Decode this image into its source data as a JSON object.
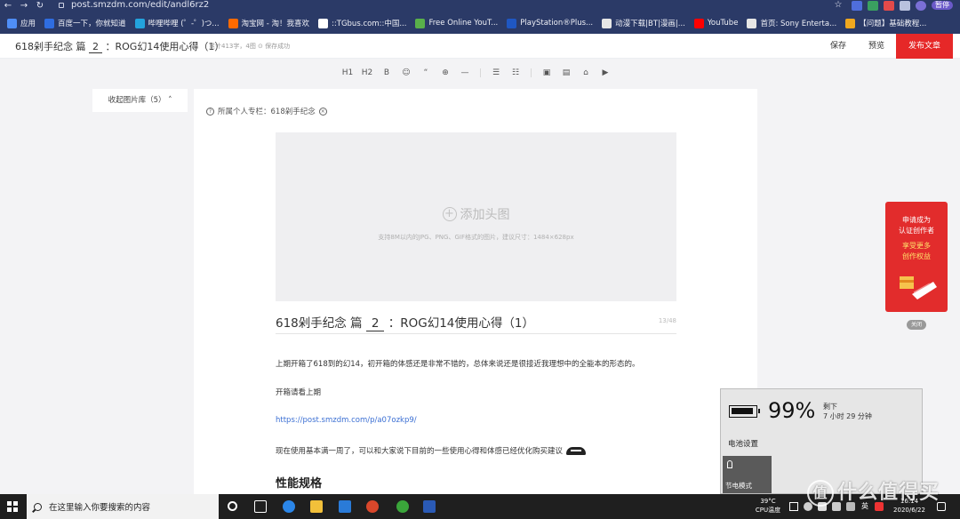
{
  "browser": {
    "url": "post.smzdm.com/edit/andl6rz2",
    "profile_label": "暂停",
    "bookmarks": [
      {
        "label": "应用",
        "color": "#4f8ef7"
      },
      {
        "label": "百度一下，你就知道",
        "color": "#2f6de1"
      },
      {
        "label": "哔哩哔哩 (゜-゜)つ...",
        "color": "#23a3dd"
      },
      {
        "label": "淘宝网 - 淘！我喜欢",
        "color": "#ff6a00"
      },
      {
        "label": "::TGbus.com::中国...",
        "color": "#ffffff"
      },
      {
        "label": "Free Online YouT...",
        "color": "#59b04a"
      },
      {
        "label": "PlayStation®Plus...",
        "color": "#1f57c3"
      },
      {
        "label": "动漫下载|BT|漫画|...",
        "color": "#e6e6e6"
      },
      {
        "label": "YouTube",
        "color": "#ff0000"
      },
      {
        "label": "首页: Sony Enterta...",
        "color": "#e6e6e6"
      },
      {
        "label": "【问题】基础教程...",
        "color": "#f0a81f"
      }
    ]
  },
  "editor": {
    "header_title_pre": "618剁手纪念 篇",
    "header_title_num": "2",
    "header_title_post": "：ROG幻14使用心得（1）",
    "meta": "累计413字，4图  ⊙ 保存成功",
    "save": "保存",
    "preview": "预览",
    "publish": "发布文章",
    "toolbar": [
      "H1",
      "H2",
      "B",
      "☺",
      "“",
      "⊕",
      "—",
      "|",
      "☰",
      "☷",
      "|",
      "▣",
      "▤",
      "⌂",
      "▶"
    ],
    "gallery_tab": "收起图片库（5）",
    "column_label": "所属个人专栏：618剁手纪念",
    "cover_add": "添加头图",
    "cover_hint": "支持8M以内的JPG、PNG、GIF格式的图片，建议尺寸：1484×628px",
    "article_title_pre": "618剁手纪念 篇",
    "article_title_num": "2",
    "article_title_post": "：ROG幻14使用心得（1）",
    "title_counter": "13/48",
    "para1": "上期开箱了618到的幻14，初开箱的体感还是非常不错的，总体来说还是很接近我理想中的全能本的形态的。",
    "para2": "开箱请看上期",
    "link": "https://post.smzdm.com/p/a07ozkp9/",
    "para3": "现在使用基本满一周了，可以和大家说下目前的一些使用心得和体感已经优化购买建议",
    "section_heading": "性能规格"
  },
  "promo": {
    "line1": "申请成为",
    "line2": "认证创作者",
    "line3": "享受更多",
    "line4": "创作权益",
    "close": "关闭"
  },
  "battery": {
    "percent": "99%",
    "remaining_label": "剩下",
    "remaining": "7 小时 29 分钟",
    "settings": "电池设置",
    "saver": "节电模式"
  },
  "taskbar": {
    "search_placeholder": "在这里输入你要搜索的内容",
    "temp": "39°C",
    "temp_label": "CPU温度",
    "time": "16:14",
    "date": "2020/6/22",
    "ime": "英"
  },
  "watermark": "什么值得买"
}
